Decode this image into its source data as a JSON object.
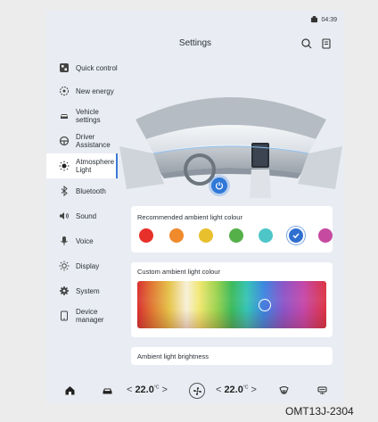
{
  "status": {
    "time": "04:39",
    "icon": "profile-icon"
  },
  "header": {
    "title": "Settings",
    "search_icon": "search-icon",
    "menu_icon": "notes-icon"
  },
  "sidebar": {
    "items": [
      {
        "label": "Quick control",
        "icon": "quick-control-icon"
      },
      {
        "label": "New energy",
        "icon": "new-energy-icon"
      },
      {
        "label": "Vehicle settings",
        "icon": "car-icon"
      },
      {
        "label": "Driver Assistance",
        "icon": "steering-wheel-icon"
      },
      {
        "label": "Atmosphere Light",
        "icon": "light-icon",
        "active": true
      },
      {
        "label": "Bluetooth",
        "icon": "bluetooth-icon"
      },
      {
        "label": "Sound",
        "icon": "speaker-icon"
      },
      {
        "label": "Voice",
        "icon": "microphone-icon"
      },
      {
        "label": "Display",
        "icon": "brightness-icon"
      },
      {
        "label": "System",
        "icon": "gear-icon"
      },
      {
        "label": "Device manager",
        "icon": "device-icon"
      }
    ]
  },
  "main": {
    "power_icon": "power-icon",
    "recommended": {
      "title": "Recommended ambient light colour",
      "colors": [
        "#e8302a",
        "#f08a2c",
        "#e8c02e",
        "#55b04a",
        "#4ec6c8",
        "#2f6fd0",
        "#c54aa0"
      ],
      "selected_index": 5
    },
    "custom": {
      "title": "Custom ambient light colour"
    },
    "brightness": {
      "title": "Ambient light brightness"
    }
  },
  "bottombar": {
    "left_temp": "22.0",
    "right_temp": "22.0",
    "unit": "°C",
    "left_arrow": "<",
    "right_arrow": ">"
  },
  "figure_code": "OMT13J-2304"
}
